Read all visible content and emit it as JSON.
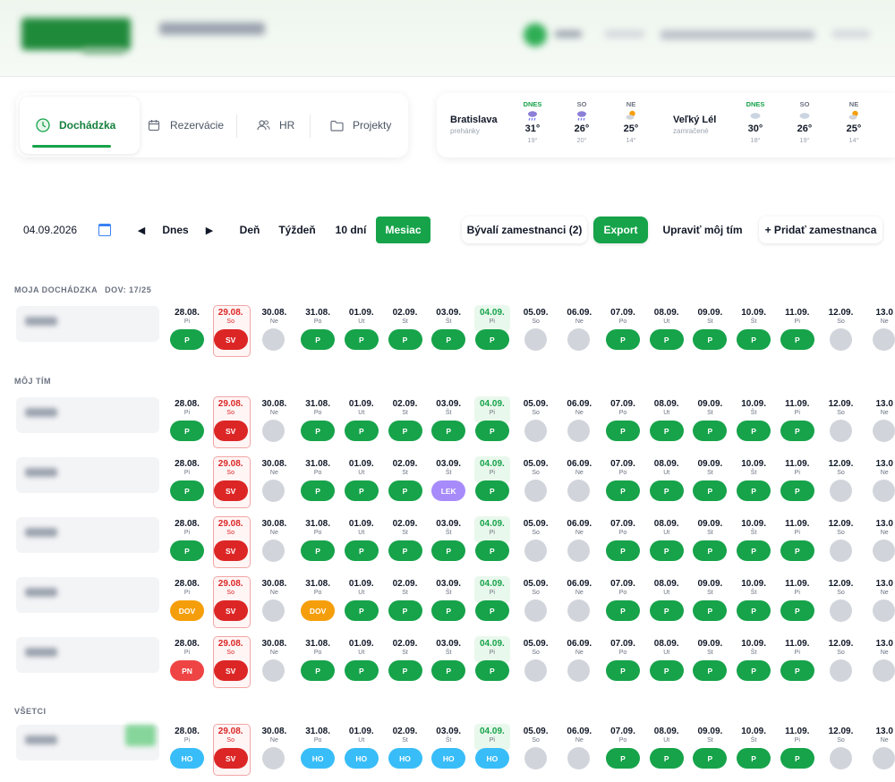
{
  "nav": {
    "items": [
      {
        "label": "Dochádzka",
        "active": true,
        "icon": "clock-icon"
      },
      {
        "label": "Rezervácie",
        "active": false,
        "icon": "calendar-icon"
      },
      {
        "label": "HR",
        "active": false,
        "icon": "users-icon"
      },
      {
        "label": "Projekty",
        "active": false,
        "icon": "folder-icon"
      }
    ]
  },
  "weather": {
    "cities": [
      {
        "name": "Bratislava",
        "condition": "prehánky",
        "days": [
          {
            "label": "DNES",
            "icon": "rain-cloud-icon",
            "high": "31°",
            "low": "19°"
          },
          {
            "label": "SO",
            "icon": "rain-cloud-icon",
            "high": "26°",
            "low": "20°"
          },
          {
            "label": "NE",
            "icon": "sun-cloud-icon",
            "high": "25°",
            "low": "14°"
          }
        ]
      },
      {
        "name": "Veľký Lél",
        "condition": "zamračené",
        "days": [
          {
            "label": "DNES",
            "icon": "cloud-icon",
            "high": "30°",
            "low": "18°"
          },
          {
            "label": "SO",
            "icon": "cloud-icon",
            "high": "26°",
            "low": "19°"
          },
          {
            "label": "NE",
            "icon": "sun-cloud-icon",
            "high": "25°",
            "low": "14°"
          }
        ]
      }
    ]
  },
  "toolbar": {
    "date": "04.09.2026",
    "prev": "◀",
    "today": "Dnes",
    "next": "▶",
    "views": [
      "Deň",
      "Týždeň",
      "10 dní",
      "Mesiac"
    ],
    "active_view": "Mesiac",
    "former_employees": "Bývalí zamestnanci (2)",
    "export": "Export",
    "edit_team": "Upraviť môj tím",
    "add_employee": "+ Pridať zamestnanca"
  },
  "colors": {
    "P": "#16a34a",
    "SV": "#dc2626",
    "LEK": "#a78bfa",
    "DOV": "#f59e0b",
    "PN": "#ef4444",
    "HO": "#38bdf8",
    "empty": "#d1d5db"
  },
  "days": [
    {
      "date": "28.08.",
      "dow": "Pi",
      "type": "work"
    },
    {
      "date": "29.08.",
      "dow": "So",
      "type": "holiday"
    },
    {
      "date": "30.08.",
      "dow": "Ne",
      "type": "weekend"
    },
    {
      "date": "31.08.",
      "dow": "Po",
      "type": "work"
    },
    {
      "date": "01.09.",
      "dow": "Ut",
      "type": "work"
    },
    {
      "date": "02.09.",
      "dow": "St",
      "type": "work"
    },
    {
      "date": "03.09.",
      "dow": "Št",
      "type": "work"
    },
    {
      "date": "04.09.",
      "dow": "Pi",
      "type": "today"
    },
    {
      "date": "05.09.",
      "dow": "So",
      "type": "weekend"
    },
    {
      "date": "06.09.",
      "dow": "Ne",
      "type": "weekend"
    },
    {
      "date": "07.09.",
      "dow": "Po",
      "type": "work"
    },
    {
      "date": "08.09.",
      "dow": "Ut",
      "type": "work"
    },
    {
      "date": "09.09.",
      "dow": "St",
      "type": "work"
    },
    {
      "date": "10.09.",
      "dow": "Št",
      "type": "work"
    },
    {
      "date": "11.09.",
      "dow": "Pi",
      "type": "work"
    },
    {
      "date": "12.09.",
      "dow": "So",
      "type": "weekend"
    },
    {
      "date": "13.0",
      "dow": "Ne",
      "type": "weekend"
    }
  ],
  "sections": [
    {
      "title": "MOJA DOCHÁDZKA",
      "subtitle": "DOV: 17/25",
      "rows": [
        [
          "P",
          "SV",
          "",
          "P",
          "P",
          "P",
          "P",
          "P",
          "",
          "",
          "P",
          "P",
          "P",
          "P",
          "P",
          "",
          ""
        ]
      ]
    },
    {
      "title": "MÔJ TÍM",
      "subtitle": "",
      "rows": [
        [
          "P",
          "SV",
          "",
          "P",
          "P",
          "P",
          "P",
          "P",
          "",
          "",
          "P",
          "P",
          "P",
          "P",
          "P",
          "",
          ""
        ],
        [
          "P",
          "SV",
          "",
          "P",
          "P",
          "P",
          "LEK",
          "P",
          "",
          "",
          "P",
          "P",
          "P",
          "P",
          "P",
          "",
          ""
        ],
        [
          "P",
          "SV",
          "",
          "P",
          "P",
          "P",
          "P",
          "P",
          "",
          "",
          "P",
          "P",
          "P",
          "P",
          "P",
          "",
          ""
        ],
        [
          "DOV",
          "SV",
          "",
          "DOV",
          "P",
          "P",
          "P",
          "P",
          "",
          "",
          "P",
          "P",
          "P",
          "P",
          "P",
          "",
          ""
        ],
        [
          "PN",
          "SV",
          "",
          "P",
          "P",
          "P",
          "P",
          "P",
          "",
          "",
          "P",
          "P",
          "P",
          "P",
          "P",
          "",
          ""
        ]
      ]
    },
    {
      "title": "VŠETCI",
      "subtitle": "",
      "rows": [
        [
          "HO",
          "SV",
          "",
          "HO",
          "HO",
          "HO",
          "HO",
          "HO",
          "",
          "",
          "P",
          "P",
          "P",
          "P",
          "P",
          "",
          ""
        ]
      ]
    }
  ]
}
